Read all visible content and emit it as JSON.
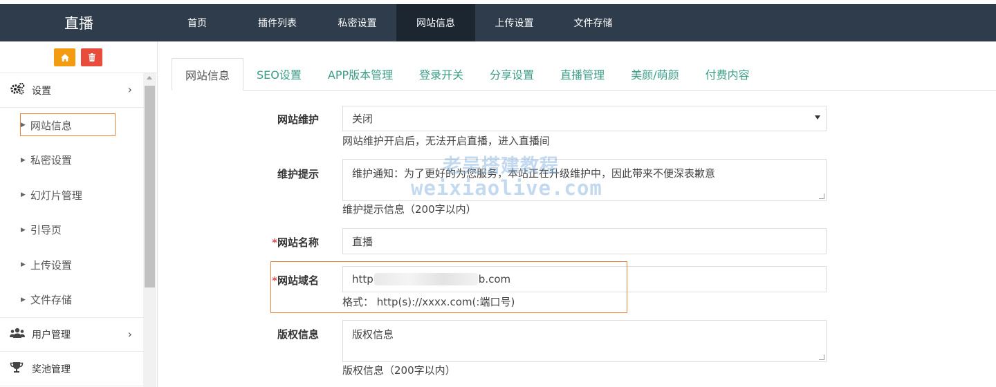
{
  "topbar": {
    "brand": "直播",
    "nav": [
      {
        "label": "首页",
        "active": false
      },
      {
        "label": "插件列表",
        "active": false
      },
      {
        "label": "私密设置",
        "active": false
      },
      {
        "label": "网站信息",
        "active": true
      },
      {
        "label": "上传设置",
        "active": false
      },
      {
        "label": "文件存储",
        "active": false
      }
    ],
    "colors": {
      "bar": "#2f3c4b",
      "active": "#1c2631"
    }
  },
  "sidebar": {
    "tools": [
      {
        "icon": "home-icon",
        "color": "#f39c12"
      },
      {
        "icon": "trash-icon",
        "color": "#e74c3c"
      }
    ],
    "groups": [
      {
        "label": "设置",
        "icon": "gears-icon"
      },
      {
        "label": "用户管理",
        "icon": "users-icon"
      },
      {
        "label": "奖池管理",
        "icon": "trophy-icon"
      }
    ],
    "items": [
      {
        "label": "网站信息",
        "active": true
      },
      {
        "label": "私密设置"
      },
      {
        "label": "幻灯片管理"
      },
      {
        "label": "引导页"
      },
      {
        "label": "上传设置"
      },
      {
        "label": "文件存储"
      }
    ]
  },
  "tabs": [
    {
      "label": "网站信息",
      "active": true
    },
    {
      "label": "SEO设置"
    },
    {
      "label": "APP版本管理"
    },
    {
      "label": "登录开关"
    },
    {
      "label": "分享设置"
    },
    {
      "label": "直播管理"
    },
    {
      "label": "美颜/萌颜"
    },
    {
      "label": "付费内容"
    }
  ],
  "form": {
    "maintenance": {
      "label": "网站维护",
      "value": "关闭",
      "help": "网站维护开启后，无法开启直播，进入直播间"
    },
    "maintenance_tip": {
      "label": "维护提示",
      "value": "维护通知：为了更好的为您服务，本站正在升级维护中，因此带来不便深表歉意",
      "help": "维护提示信息（200字以内）"
    },
    "site_name": {
      "required_mark": "*",
      "label": "网站名称",
      "value": "直播"
    },
    "site_domain": {
      "required_mark": "*",
      "label": "网站域名",
      "value_prefix": "http",
      "value_suffix": "b.com",
      "help": "格式： http(s)://xxxx.com(:端口号)"
    },
    "copyright": {
      "label": "版权信息",
      "value": "版权信息",
      "help": "版权信息（200字以内）"
    }
  },
  "watermark": {
    "line1": "老吴搭建教程",
    "line2": "weixiaolive.com"
  },
  "accent": "#3c9d87",
  "highlight_color": "#e8823a"
}
